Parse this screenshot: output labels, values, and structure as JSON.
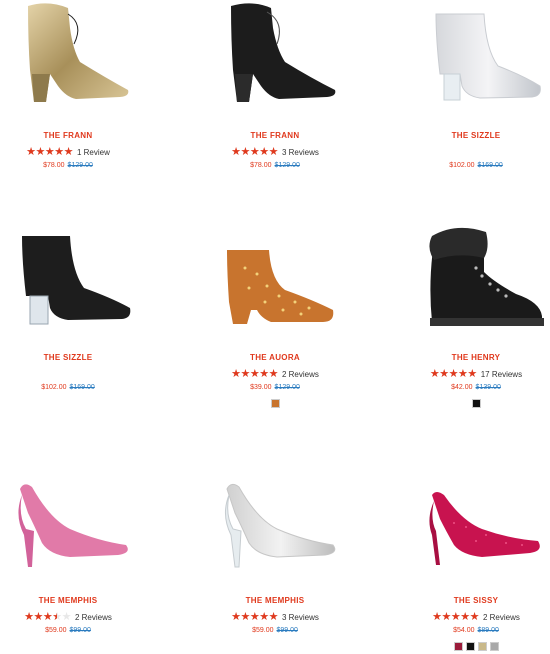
{
  "products": [
    {
      "name": "THE FRANN",
      "rating": 5,
      "reviews": "1 Review",
      "price": "$78.00",
      "original": "$129.00",
      "swatches": [],
      "image": "gold-boot-icon"
    },
    {
      "name": "THE FRANN",
      "rating": 5,
      "reviews": "3 Reviews",
      "price": "$78.00",
      "original": "$129.00",
      "swatches": [],
      "image": "black-boot-icon"
    },
    {
      "name": "THE SIZZLE",
      "rating": null,
      "reviews": "",
      "price": "$102.00",
      "original": "$169.00",
      "swatches": [],
      "image": "silver-bootie-icon"
    },
    {
      "name": "THE SIZZLE",
      "rating": null,
      "reviews": "",
      "price": "$102.00",
      "original": "$169.00",
      "swatches": [],
      "image": "black-bootie-icon"
    },
    {
      "name": "THE AUORA",
      "rating": 5,
      "reviews": "2 Reviews",
      "price": "$39.00",
      "original": "$129.00",
      "swatches": [
        "#c8742e"
      ],
      "image": "tan-studded-bootie-icon"
    },
    {
      "name": "THE HENRY",
      "rating": 5,
      "reviews": "17 Reviews",
      "price": "$42.00",
      "original": "$139.00",
      "swatches": [
        "#111111"
      ],
      "image": "black-combat-boot-icon"
    },
    {
      "name": "THE MEMPHIS",
      "rating": 3.5,
      "reviews": "2 Reviews",
      "price": "$59.00",
      "original": "$99.00",
      "swatches": [],
      "image": "pink-pump-icon"
    },
    {
      "name": "THE MEMPHIS",
      "rating": 5,
      "reviews": "3 Reviews",
      "price": "$59.00",
      "original": "$99.00",
      "swatches": [],
      "image": "silver-pump-icon"
    },
    {
      "name": "THE SISSY",
      "rating": 5,
      "reviews": "2 Reviews",
      "price": "$54.00",
      "original": "$89.00",
      "swatches": [
        "#9b1b3a",
        "#111111",
        "#c9b98a",
        "#a9a9a9"
      ],
      "image": "pink-glitter-pump-icon"
    }
  ],
  "colors": {
    "accent": "#e0391d",
    "link": "#2a7bbf"
  }
}
